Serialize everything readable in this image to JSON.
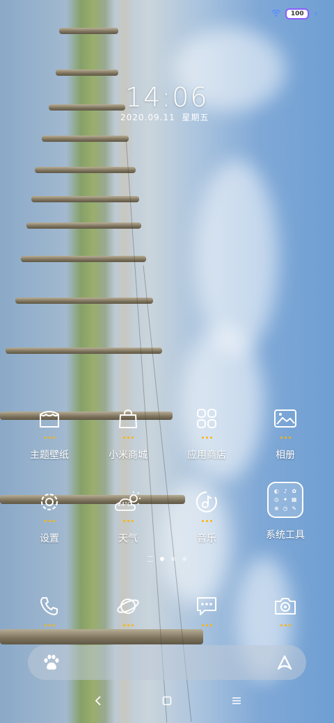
{
  "status": {
    "wifi_icon": "wifi-icon",
    "battery_level": "100",
    "charging_icon": "bolt-icon"
  },
  "clock": {
    "time": "14:06",
    "date": "2020.09.11",
    "weekday": "星期五"
  },
  "apps_row1": [
    {
      "label": "主题壁纸",
      "icon": "theme-icon"
    },
    {
      "label": "小米商城",
      "icon": "shopping-bag-icon"
    },
    {
      "label": "应用商店",
      "icon": "app-store-icon"
    },
    {
      "label": "相册",
      "icon": "gallery-icon"
    }
  ],
  "apps_row2": [
    {
      "label": "设置",
      "icon": "settings-gear-icon"
    },
    {
      "label": "天气",
      "icon": "weather-icon",
      "temperature": "24°C"
    },
    {
      "label": "音乐",
      "icon": "music-icon"
    },
    {
      "label": "系统工具",
      "icon": "system-tools-folder-icon"
    }
  ],
  "dock": [
    {
      "icon": "phone-icon"
    },
    {
      "icon": "browser-planet-icon"
    },
    {
      "icon": "messages-icon"
    },
    {
      "icon": "camera-icon"
    }
  ],
  "page_indicator": {
    "pages": 3,
    "current": 1
  },
  "search_bar": {
    "left_icon": "paw-icon",
    "right_icon": "assistant-icon"
  },
  "nav": {
    "back": "back-icon",
    "home": "home-icon",
    "menu": "menu-icon"
  }
}
